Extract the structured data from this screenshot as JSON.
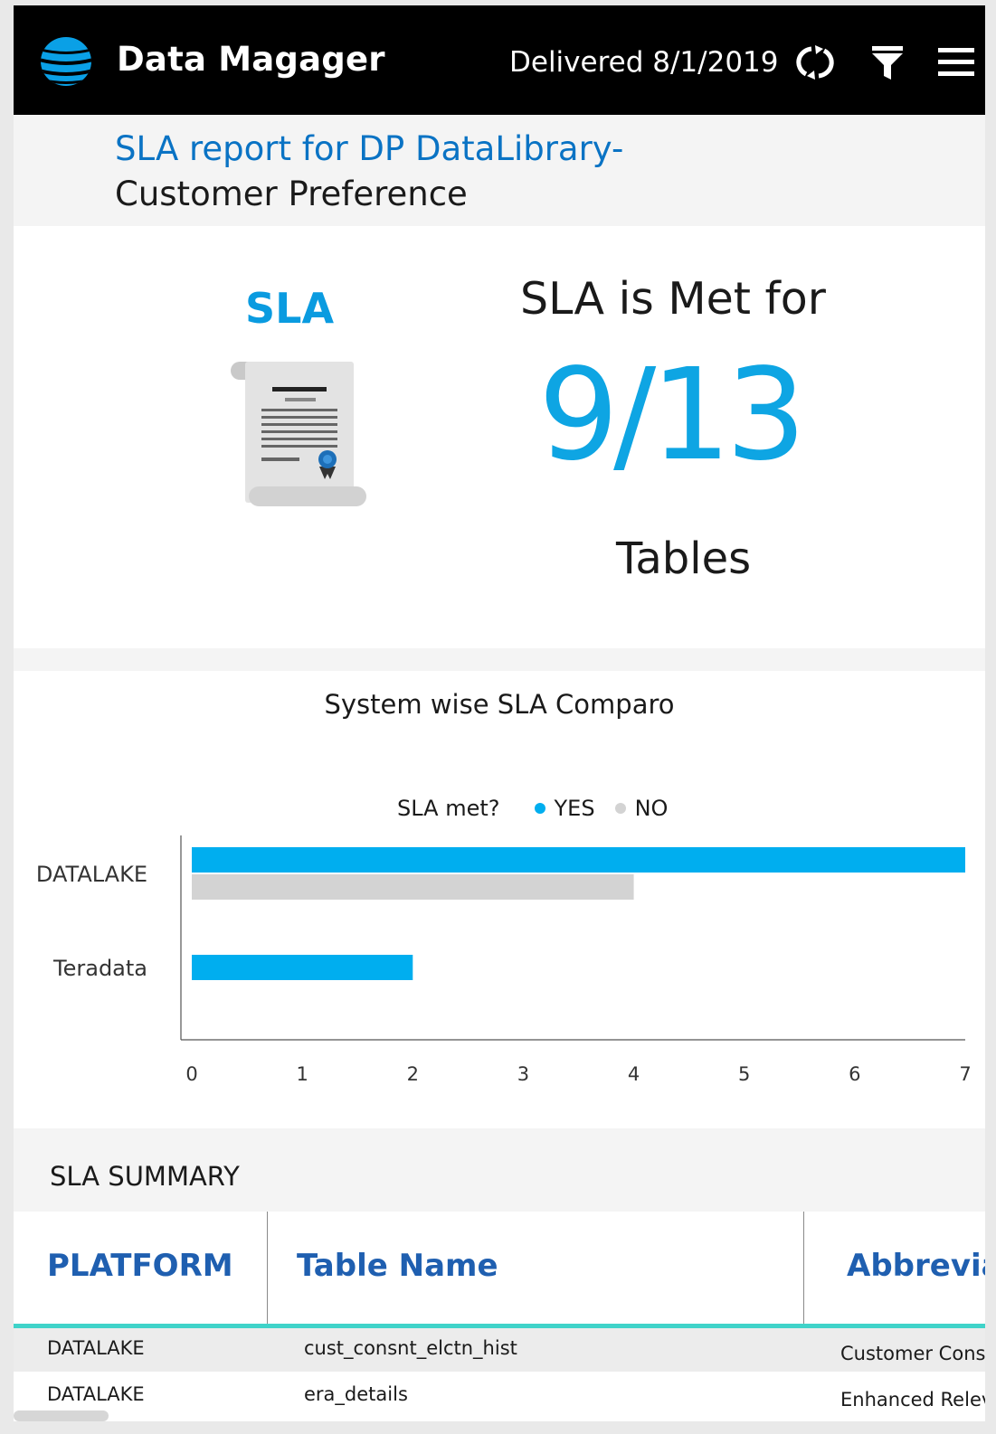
{
  "header": {
    "app_title": "Data Magager",
    "delivered": "Delivered 8/1/2019",
    "icons": [
      "att-globe-logo",
      "refresh-icon",
      "filter-icon",
      "hamburger-menu-icon"
    ]
  },
  "report_title": {
    "line1": "SLA report for DP DataLibrary-",
    "line2": "Customer Preference"
  },
  "kpi": {
    "label": "SLA",
    "heading": "SLA is Met for",
    "value": "9/13",
    "unit": "Tables",
    "icon": "certificate-scroll-icon"
  },
  "chart_data": {
    "type": "bar",
    "orientation": "horizontal",
    "title": "System wise SLA Comparo",
    "legend_title": "SLA met?",
    "legend_position": "top-center",
    "categories": [
      "DATALAKE",
      "Teradata"
    ],
    "series": [
      {
        "name": "YES",
        "color": "#00aeef",
        "values": [
          7,
          2
        ]
      },
      {
        "name": "NO",
        "color": "#d3d3d3",
        "values": [
          4,
          0
        ]
      }
    ],
    "x_ticks": [
      "0",
      "1",
      "2",
      "3",
      "4",
      "5",
      "6",
      "7"
    ],
    "xlim": [
      0,
      7
    ],
    "grid": false
  },
  "summary": {
    "title": "SLA SUMMARY",
    "columns": [
      "PLATFORM",
      "Table Name",
      "Abbrevia"
    ],
    "rows": [
      [
        "DATALAKE",
        "cust_consnt_elctn_hist",
        "Customer Conse"
      ],
      [
        "DATALAKE",
        "era_details",
        "Enhanced Relev"
      ]
    ]
  },
  "colors": {
    "accent_blue": "#0ea5e3",
    "title_blue": "#0a73c4",
    "header_blue": "#1f5fb0",
    "divider_teal": "#3fd3c9"
  }
}
